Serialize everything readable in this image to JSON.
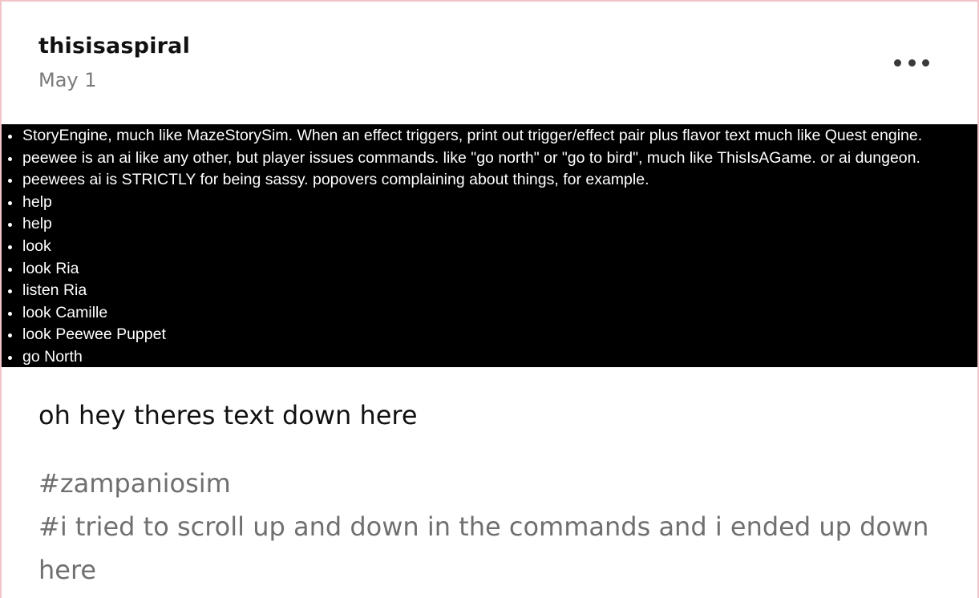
{
  "post": {
    "username": "thisisaspiral",
    "date": "May 1",
    "more_icon": "ellipsis-horizontal-icon",
    "image_lines": [
      "StoryEngine, much like MazeStorySim. When an effect triggers, print out trigger/effect pair plus flavor text much like Quest engine.",
      "peewee is an ai like any other, but player issues commands. like \"go north\" or \"go to bird\", much like ThisIsAGame. or ai dungeon.",
      "peewees ai is STRICTLY for being sassy. popovers complaining about things, for example.",
      "help",
      "help",
      "look",
      "look Ria",
      "listen Ria",
      "look Camille",
      "look Peewee Puppet",
      "go North"
    ],
    "body_text": "oh hey theres text down here",
    "tags": [
      "#zampaniosim",
      "#i tried to scroll up and down in the commands and i ended up down here"
    ]
  },
  "colors": {
    "border": "#f2c4c8",
    "image_background": "#000000",
    "tag_text": "#6f6f6f"
  }
}
